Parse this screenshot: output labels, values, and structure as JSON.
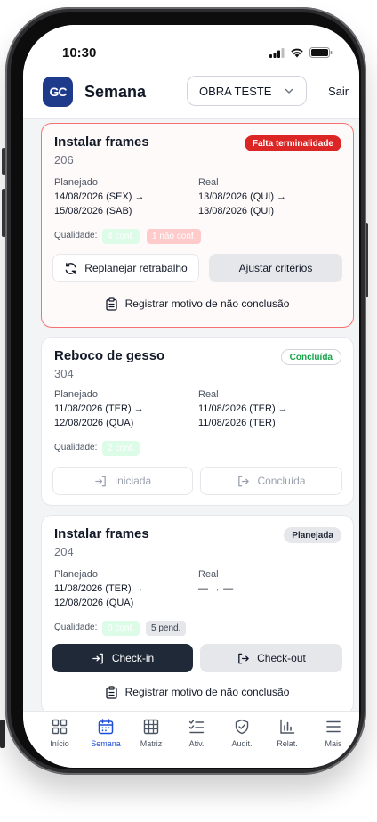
{
  "status_bar": {
    "time": "10:30"
  },
  "header": {
    "logo_text": "GC",
    "title": "Semana",
    "obra_select": {
      "selected": "OBRA TESTE"
    },
    "logout_label": "Sair"
  },
  "cards": [
    {
      "title": "Instalar frames",
      "code": "206",
      "status": "Falta terminalidade",
      "planned_label": "Planejado",
      "planned_line1": "14/08/2026 (SEX) →",
      "planned_line2": "15/08/2026 (SAB)",
      "real_label": "Real",
      "real_line1": "13/08/2026 (QUI) →",
      "real_line2": "13/08/2026 (QUI)",
      "quality_label": "Qualidade:",
      "quality_chips": [
        "4 conf.",
        "1 não conf."
      ],
      "buttons": [
        "Replanejar retrabalho",
        "Ajustar critérios"
      ],
      "link": "Registrar motivo de não conclusão"
    },
    {
      "title": "Reboco de gesso",
      "code": "304",
      "status": "Concluída",
      "planned_label": "Planejado",
      "planned_line1": "11/08/2026 (TER) →",
      "planned_line2": "12/08/2026 (QUA)",
      "real_label": "Real",
      "real_line1": "11/08/2026 (TER) →",
      "real_line2": "11/08/2026 (TER)",
      "quality_label": "Qualidade:",
      "quality_chips": [
        "2 conf."
      ],
      "buttons": [
        "Iniciada",
        "Concluída"
      ]
    },
    {
      "title": "Instalar frames",
      "code": "204",
      "status": "Planejada",
      "planned_label": "Planejado",
      "planned_line1": "11/08/2026 (TER) →",
      "planned_line2": "12/08/2026 (QUA)",
      "real_label": "Real",
      "real_line1": "— → —",
      "quality_label": "Qualidade:",
      "quality_chips": [
        "0 conf.",
        "5 pend."
      ],
      "buttons": [
        "Check-in",
        "Check-out"
      ],
      "link": "Registrar motivo de não conclusão"
    }
  ],
  "bottom_nav": [
    {
      "label": "Início",
      "icon": "grid-icon"
    },
    {
      "label": "Semana",
      "icon": "calendar-icon",
      "active": true
    },
    {
      "label": "Matriz",
      "icon": "table-icon"
    },
    {
      "label": "Ativ.",
      "icon": "checklist-icon"
    },
    {
      "label": "Audit.",
      "icon": "shield-check-icon"
    },
    {
      "label": "Relat.",
      "icon": "bar-chart-icon"
    },
    {
      "label": "Mais",
      "icon": "menu-icon"
    }
  ],
  "colors": {
    "brand": "#1e3a8a",
    "active_nav": "#1d4ed8",
    "alert_border": "#f87171",
    "danger_badge": "#dc2626",
    "success_text": "#16a34a",
    "primary_button": "#1f2937"
  }
}
